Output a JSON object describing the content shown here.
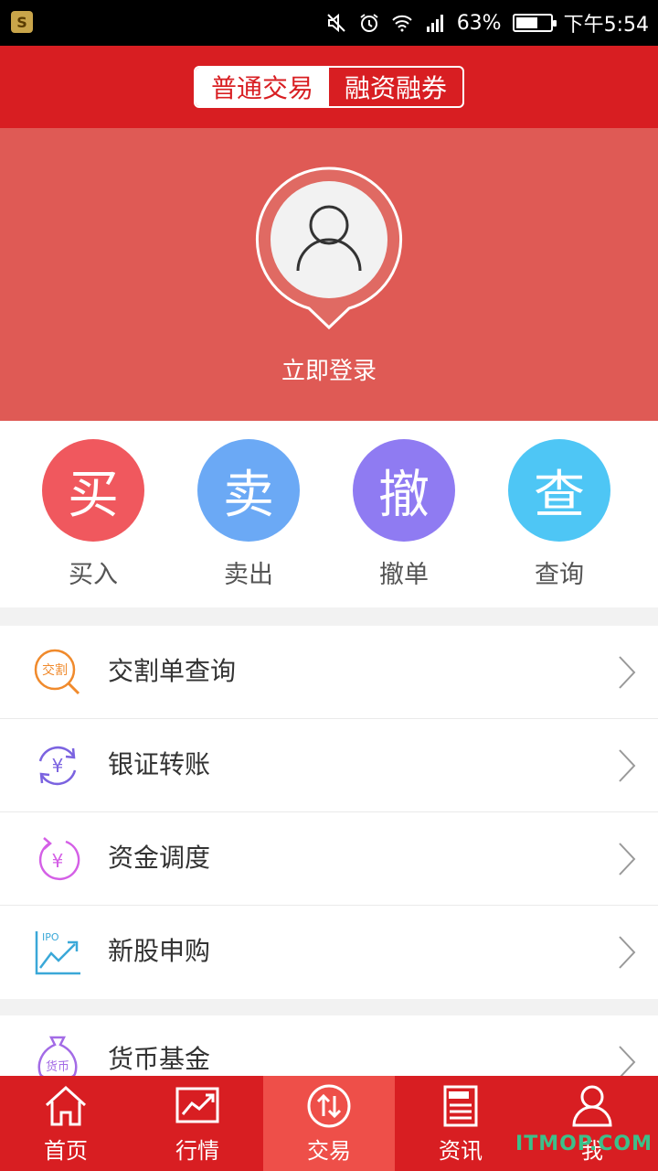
{
  "status_bar": {
    "app_icon_letter": "S",
    "battery": "63%",
    "battery_level": 0.63,
    "time": "下午5:54"
  },
  "header": {
    "segments": [
      {
        "label": "普通交易",
        "active": true
      },
      {
        "label": "融资融券",
        "active": false
      }
    ]
  },
  "login": {
    "label": "立即登录"
  },
  "actions": [
    {
      "glyph": "买",
      "label": "买入",
      "color": "#f0585e"
    },
    {
      "glyph": "卖",
      "label": "卖出",
      "color": "#6ba9f5"
    },
    {
      "glyph": "撤",
      "label": "撤单",
      "color": "#8f7bf2"
    },
    {
      "glyph": "查",
      "label": "查询",
      "color": "#4ec6f5"
    }
  ],
  "menu": [
    {
      "label": "交割单查询",
      "icon": "delivery-query-icon",
      "icon_text": "交割",
      "color": "#f08a2c"
    },
    {
      "label": "银证转账",
      "icon": "bank-transfer-icon",
      "icon_text": "¥",
      "color": "#7b63e0"
    },
    {
      "label": "资金调度",
      "icon": "fund-dispatch-icon",
      "icon_text": "¥",
      "color": "#d45fe6"
    },
    {
      "label": "新股申购",
      "icon": "ipo-subscribe-icon",
      "icon_text": "IPO",
      "color": "#3aa8d8"
    }
  ],
  "menu2": [
    {
      "label": "货币基金",
      "icon": "money-fund-icon",
      "icon_text": "货币",
      "color": "#a36be6"
    }
  ],
  "tabs": [
    {
      "label": "首页",
      "icon": "home-icon",
      "active": false
    },
    {
      "label": "行情",
      "icon": "market-chart-icon",
      "active": false
    },
    {
      "label": "交易",
      "icon": "trade-icon",
      "active": true
    },
    {
      "label": "资讯",
      "icon": "news-icon",
      "active": false
    },
    {
      "label": "我",
      "icon": "user-icon",
      "active": false
    }
  ],
  "watermark": "ITMOP.COM",
  "colors": {
    "brand_red": "#d81e22",
    "banner_red": "#df5a55",
    "active_tab": "#ee4f49"
  }
}
